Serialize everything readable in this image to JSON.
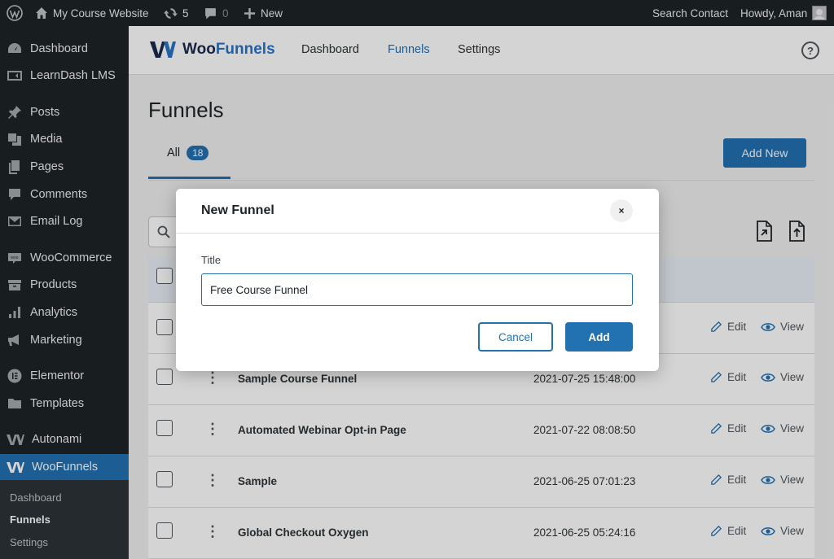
{
  "adminbar": {
    "site_name": "My Course Website",
    "updates_count": "5",
    "comments_count": "0",
    "new_label": "New",
    "search_label": "Search Contact",
    "howdy": "Howdy, Aman"
  },
  "sidebar": {
    "items": [
      {
        "label": "Dashboard",
        "icon": "dashboard-icon"
      },
      {
        "label": "LearnDash LMS",
        "icon": "learndash-icon"
      },
      {
        "label": "Posts",
        "icon": "pin-icon"
      },
      {
        "label": "Media",
        "icon": "media-icon"
      },
      {
        "label": "Pages",
        "icon": "pages-icon"
      },
      {
        "label": "Comments",
        "icon": "comment-icon"
      },
      {
        "label": "Email Log",
        "icon": "email-icon"
      },
      {
        "label": "WooCommerce",
        "icon": "woo-icon"
      },
      {
        "label": "Products",
        "icon": "box-icon"
      },
      {
        "label": "Analytics",
        "icon": "bar-chart-icon"
      },
      {
        "label": "Marketing",
        "icon": "megaphone-icon"
      },
      {
        "label": "Elementor",
        "icon": "elementor-icon"
      },
      {
        "label": "Templates",
        "icon": "folder-icon"
      },
      {
        "label": "Autonami",
        "icon": "autonami-icon"
      },
      {
        "label": "WooFunnels",
        "icon": "woofunnels-icon"
      }
    ],
    "submenu": [
      "Dashboard",
      "Funnels",
      "Settings"
    ]
  },
  "header": {
    "logo_part1": "Woo",
    "logo_part2": "Funnels",
    "nav": [
      "Dashboard",
      "Funnels",
      "Settings"
    ],
    "help": "?"
  },
  "main": {
    "title": "Funnels",
    "tab_all_label": "All",
    "tab_all_count": "18",
    "add_new_label": "Add New"
  },
  "table": {
    "edit_label": "Edit",
    "view_label": "View",
    "rows": [
      {
        "name": "",
        "date": ""
      },
      {
        "name": "Sample Course Funnel",
        "date": "2021-07-25 15:48:00"
      },
      {
        "name": "Automated Webinar Opt-in Page",
        "date": "2021-07-22 08:08:50"
      },
      {
        "name": "Sample",
        "date": "2021-06-25 07:01:23"
      },
      {
        "name": "Global Checkout Oxygen",
        "date": "2021-06-25 05:24:16"
      }
    ]
  },
  "modal": {
    "title": "New Funnel",
    "close": "×",
    "field_label": "Title",
    "field_value": "Free Course Funnel",
    "cancel_label": "Cancel",
    "add_label": "Add"
  },
  "colors": {
    "accent": "#2271b1",
    "admin_dark": "#1d2327",
    "logo_dark": "#1b2a4e",
    "logo_blue": "#2a74c8"
  }
}
